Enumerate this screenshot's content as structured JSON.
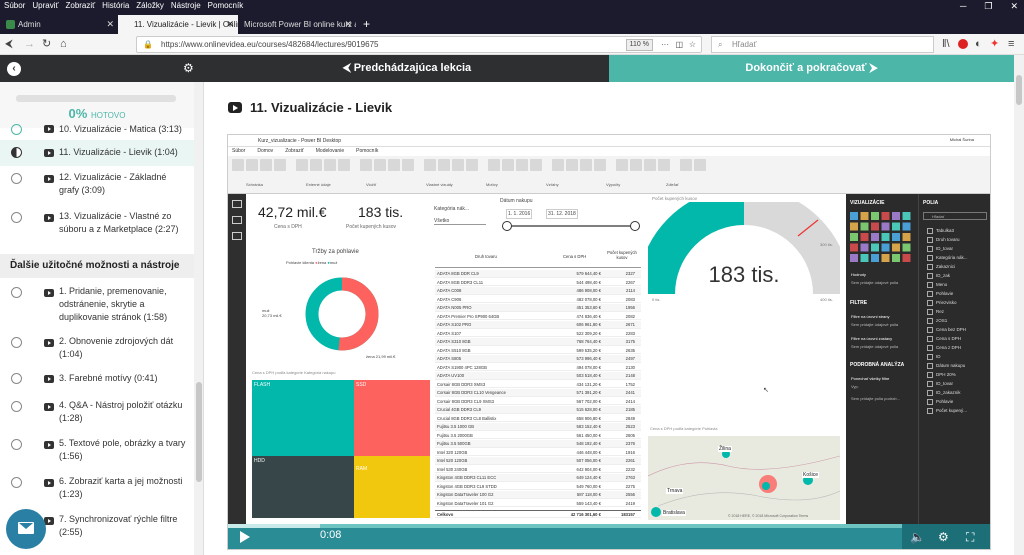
{
  "browser": {
    "menu": [
      "Súbor",
      "Upraviť",
      "Zobraziť",
      "História",
      "Záložky",
      "Nástroje",
      "Pomocník"
    ],
    "tabs": [
      {
        "label": "Admin",
        "active": false
      },
      {
        "label": "11. Vizualizácie - Lievik | Online",
        "active": true
      },
      {
        "label": "Microsoft Power BI online kurz a 8",
        "active": false
      }
    ],
    "new_tab": "+",
    "url": "https://www.onlinevidea.eu/courses/482684/lectures/9019675",
    "zoom": "110 %",
    "search_placeholder": "Hľadať"
  },
  "course_bar": {
    "prev_label": "⮜ Predchádzajúca lekcia",
    "next_label": "Dokončiť a pokračovať ⮞"
  },
  "sidebar": {
    "progress_pct": "0%",
    "progress_label": "HOTOVO",
    "progress_value": 0,
    "lectures_top": [
      {
        "label": "10. Vizualizácie - Matica (3:13)",
        "state": "done"
      },
      {
        "label": "11. Vizualizácie - Lievik (1:04)",
        "state": "active"
      },
      {
        "label": "12. Vizualizácie - Základné grafy (3:09)",
        "state": "todo"
      },
      {
        "label": "13. Vizualizácie - Vlastné zo súboru a z Marketplace (2:27)",
        "state": "todo"
      }
    ],
    "section_title": "Ďalšie užitočné možnosti a nástroje",
    "lectures_bottom": [
      {
        "label": "1. Pridanie, premenovanie, odstránenie, skrytie a duplikovanie stránok (1:58)"
      },
      {
        "label": "2. Obnovenie zdrojových dát (1:04)"
      },
      {
        "label": "3. Farebné motívy (0:41)"
      },
      {
        "label": "4. Q&A - Nástroj položiť otázku (1:28)"
      },
      {
        "label": "5. Textové pole, obrázky a tvary (1:56)"
      },
      {
        "label": "6. Zobraziť karta a jej možnosti (1:23)"
      },
      {
        "label": "7. Synchronizovať rýchle filtre (2:55)"
      }
    ]
  },
  "lecture_title": "11. Vizualizácie - Lievik",
  "player": {
    "time": "0:08",
    "progress": 0.12,
    "pbi_title": "Kurz_vizualizacie - Power BI Desktop",
    "pbi_user": "Michal Šurina",
    "pbi_tabs": [
      "Súbor",
      "Domov",
      "Zobraziť",
      "Modelovanie",
      "Pomocník"
    ],
    "ribbon_groups": [
      "Schránka",
      "Externé údaje",
      "Vložiť",
      "Vlastné vizuály",
      "Motívy",
      "Vzťahy",
      "Výpočty",
      "Zdieľať"
    ],
    "kpi1_value": "42,72 mil.€",
    "kpi1_label": "Cena s DPH",
    "kpi2_value": "183 tis.",
    "kpi2_label": "Počet kupených kusov",
    "slicer_cat_label": "Kategória nák...",
    "slicer_cat_value": "Všetko",
    "date_label": "Dátum nakupu",
    "date_from": "1. 1. 2016",
    "date_to": "31. 12. 2018",
    "gauge_title": "Počet kupených kusov",
    "gauge_value": "183 tis.",
    "gauge_min": "0 tis.",
    "gauge_max": "400 tis.",
    "gauge_target": "300 tis.",
    "donut_title": "Tržby za pohlavie",
    "donut_legend_title": "Pohlavie klienta",
    "donut_legend": [
      "žena",
      "muž"
    ],
    "donut_label_men": "muž\n20,73 mil.€",
    "donut_label_women": "žena 21,99 mil.€",
    "treemap_title": "Cena s DPH podľa kategórie Kategória nakupu",
    "treemap": [
      {
        "label": "FLASH",
        "color": "#01b8aa"
      },
      {
        "label": "SSD",
        "color": "#fd625e"
      },
      {
        "label": "HDD",
        "color": "#374649"
      },
      {
        "label": "RAM",
        "color": "#f2c80f"
      }
    ],
    "table_headers": [
      "Druh tovaru",
      "Cena s DPH",
      "Počet kupených kusov"
    ],
    "table_rows": [
      [
        "ADATA 8GB DDR CL9",
        "579 644,40 €",
        "2327"
      ],
      [
        "ADATA 8GB DDR3 CL11",
        "544 498,40 €",
        "2267"
      ],
      [
        "ADATA C008",
        "486 908,00 €",
        "2114"
      ],
      [
        "ADATA C906",
        "482 078,00 €",
        "2083"
      ],
      [
        "ADATA N005 PRO",
        "451 353,60 €",
        "1956"
      ],
      [
        "ADATA Premier Pro SP900 64GB",
        "474 836,40 €",
        "2082"
      ],
      [
        "ADATA S102 PRO",
        "606 961,80 €",
        "2671"
      ],
      [
        "ADATA S107",
        "522 309,20 €",
        "2283"
      ],
      [
        "ADATA S310 8GB",
        "768 764,40 €",
        "3175"
      ],
      [
        "ADATA S510 8GB",
        "599 535,20 €",
        "2635"
      ],
      [
        "ADATA S805",
        "573 996,40 €",
        "2497"
      ],
      [
        "ADATA S1900 4PC 128GB",
        "494 078,00 €",
        "2130"
      ],
      [
        "ADATA UV100",
        "503 518,40 €",
        "2148"
      ],
      [
        "Corsair 8GB DDR3 XMS3",
        "434 131,20 €",
        "1752"
      ],
      [
        "Corsair 8GB DDR3 CL10 Vengeance",
        "571 391,20 €",
        "2441"
      ],
      [
        "Corsair 8GB DDR3 CL9 XMS3",
        "567 702,00 €",
        "2414"
      ],
      [
        "Crucial 4GB DDR3 CL9",
        "515 628,00 €",
        "2185"
      ],
      [
        "Crucial 8GB DDR3 CL8 Ballistix",
        "658 906,80 €",
        "2849"
      ],
      [
        "Fujitsu 3.5 1000 GB",
        "583 152,40 €",
        "2523"
      ],
      [
        "Fujitsu 3.5 2000GB",
        "561 450,00 €",
        "2605"
      ],
      [
        "Fujitsu 3.5 500GB",
        "548 192,40 €",
        "2376"
      ],
      [
        "Intel 320 120GB",
        "446 448,00 €",
        "1916"
      ],
      [
        "Intel 520 120GB",
        "507 056,00 €",
        "2261"
      ],
      [
        "Intel 530 240GB",
        "642 904,00 €",
        "2232"
      ],
      [
        "Kingston 4GB DDR3 CL11 ECC",
        "649 124,40 €",
        "2763"
      ],
      [
        "Kingston 4GB DDR3 CL9 STDD",
        "549 760,00 €",
        "2275"
      ],
      [
        "Kingston DataTraveler 100 G2",
        "587 118,00 €",
        "2556"
      ],
      [
        "Kingston DataTraveler 101 G2",
        "559 143,40 €",
        "2419"
      ]
    ],
    "table_total": [
      "Celkovo",
      "42 716 301,60 €",
      "183157"
    ],
    "map_title": "Cena s DPH podľa kategórie Pohlavia",
    "map_cities": [
      "Žilina",
      "Košice",
      "Trnava",
      "Bratislava"
    ],
    "map_credit": "© 2018 HERE, © 2018 Microsoft Corporation  Terms",
    "vis_panel_title": "VIZUALIZÁCIE",
    "vis_rows": [
      "Hodnoty",
      "Sem pridajte údajové polia"
    ],
    "filters_title": "FILTRE",
    "filters": [
      "Filtre na úrovni strany",
      "Sem pridajte údajové polia",
      "Filtre na úrovni zostavy",
      "Sem pridajte údajové polia"
    ],
    "drill_title": "PODROBNÁ ANALÝZA",
    "drill_items": [
      "Ponechať všetky filtre",
      "Vyp.",
      "Sem pridajte polia podrob..."
    ],
    "fields_title": "POLIA",
    "fields_search": "Hľadať",
    "fields": [
      "Tabulka3",
      "Druh tovaru",
      "ID_tovar",
      "Kategória nák...",
      "Zakaznici",
      "ID_zak",
      "Meno",
      "Pohlavie",
      "Priezvisko",
      "Rez",
      "zOS1",
      "Cena bez DPH",
      "Cena s DPH",
      "Cena z DPH",
      "ID",
      "Dátum nakupu",
      "DPH 20%",
      "ID_tovar",
      "ID_zakaznik",
      "Pohlavie",
      "Počet kupený..."
    ]
  },
  "colors": {
    "accent": "#4cb6a8",
    "brand_dark": "#2d2f31",
    "treemap_flash": "#01b8aa",
    "treemap_ssd": "#fd625e",
    "treemap_hdd": "#374649",
    "treemap_ram": "#f2c80f"
  }
}
